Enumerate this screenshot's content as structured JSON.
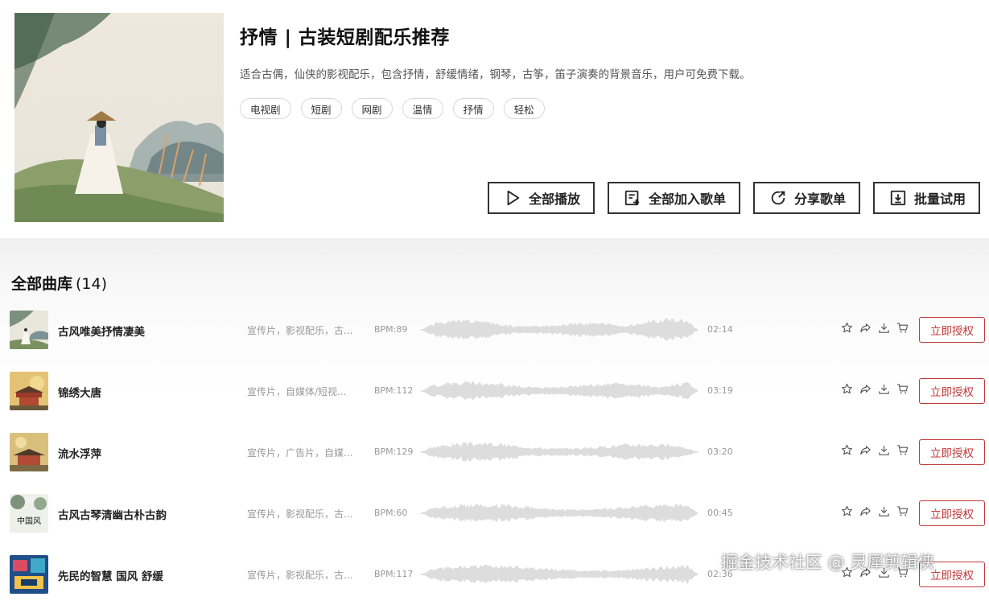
{
  "playlist": {
    "title": "抒情 | 古装短剧配乐推荐",
    "description": "适合古偶，仙侠的影视配乐，包含抒情，舒缓情绪，钢琴，古筝，笛子演奏的背景音乐，用户可免费下载。",
    "tags": [
      "电视剧",
      "短剧",
      "网剧",
      "温情",
      "抒情",
      "轻松"
    ]
  },
  "actions": {
    "play_all": "全部播放",
    "add_all": "全部加入歌单",
    "share": "分享歌单",
    "batch_trial": "批量试用"
  },
  "library": {
    "title": "全部曲库",
    "count": "(14)"
  },
  "songs": [
    {
      "name": "古风唯美抒情凄美",
      "tags": "宣传片，影视配乐，古...",
      "bpm": "BPM:89",
      "duration": "02:14",
      "license": "立即授权"
    },
    {
      "name": "锦绣大唐",
      "tags": "宣传片，自媒体/短视...",
      "bpm": "BPM:112",
      "duration": "03:19",
      "license": "立即授权"
    },
    {
      "name": "流水浮萍",
      "tags": "宣传片，广告片，自媒...",
      "bpm": "BPM:129",
      "duration": "03:20",
      "license": "立即授权"
    },
    {
      "name": "古风古琴清幽古朴古韵",
      "tags": "宣传片，影视配乐，古...",
      "bpm": "BPM:60",
      "duration": "00:45",
      "license": "立即授权"
    },
    {
      "name": "先民的智慧 国风 舒缓",
      "tags": "宣传片，影视配乐，古...",
      "bpm": "BPM:117",
      "duration": "02:36",
      "license": "立即授权"
    }
  ],
  "thumb_label_4": "中国风",
  "watermark": "掘金技术社区 @ 灵犀剪辑侠",
  "colors": {
    "accent": "#c0393b",
    "text_primary": "#222222",
    "text_muted": "#999999",
    "waveform": "#dddddd"
  },
  "icons": {
    "row": [
      "star-icon",
      "share-icon",
      "download-icon",
      "cart-icon"
    ],
    "actions": [
      "play-icon",
      "add-to-playlist-icon",
      "share-icon",
      "download-box-icon"
    ]
  }
}
